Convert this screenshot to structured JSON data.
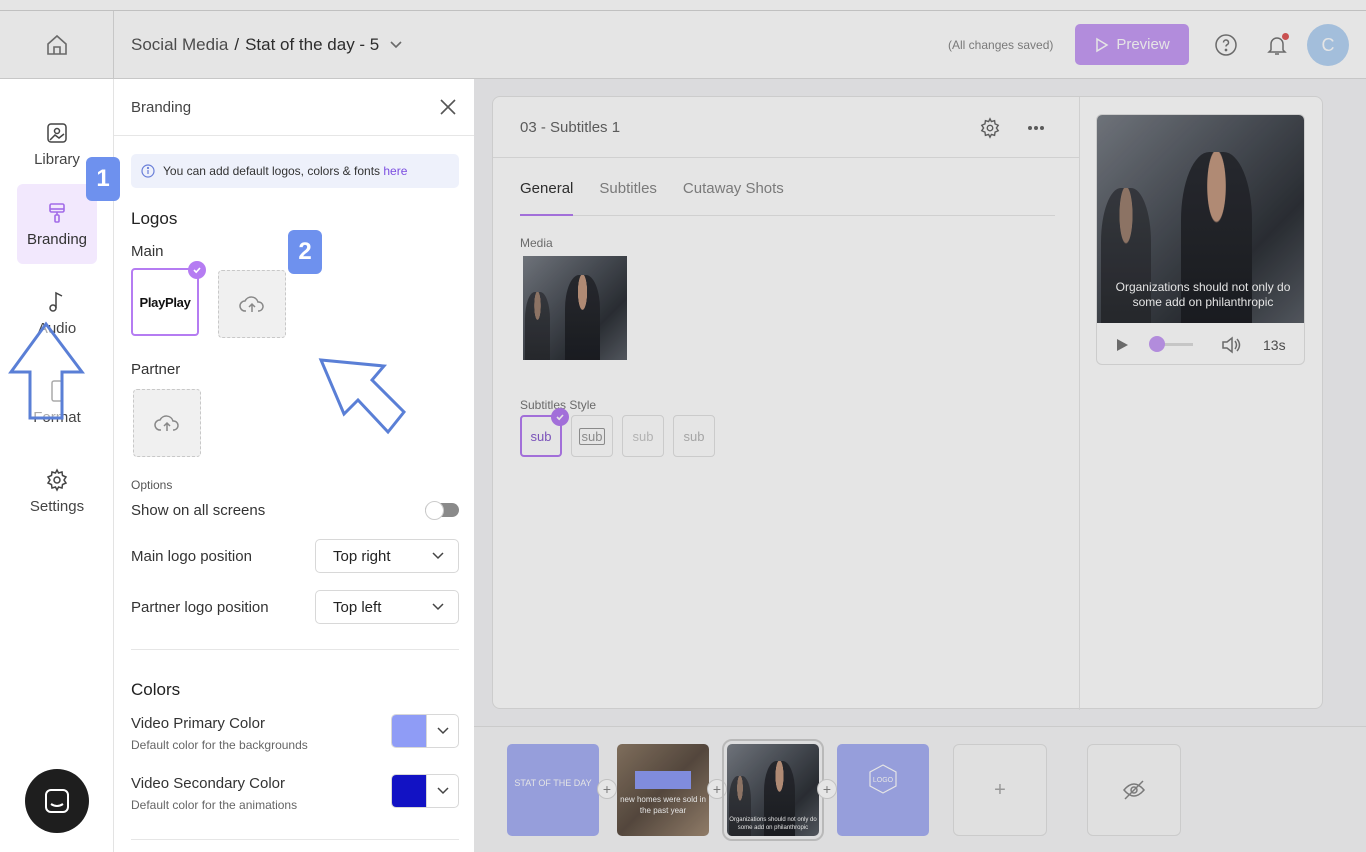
{
  "header": {
    "breadcrumb_parent": "Social Media",
    "breadcrumb_sep": "/",
    "breadcrumb_current": "Stat of the day - 5",
    "saved_status": "(All changes saved)",
    "preview_label": "Preview",
    "avatar_initial": "C"
  },
  "rail": {
    "items": [
      {
        "label": "Library",
        "icon": "image-icon"
      },
      {
        "label": "Branding",
        "icon": "paint-roller-icon"
      },
      {
        "label": "Audio",
        "icon": "music-note-icon"
      },
      {
        "label": "Format",
        "icon": "phone-format-icon"
      },
      {
        "label": "Settings",
        "icon": "gear-icon"
      }
    ]
  },
  "panel": {
    "title": "Branding",
    "info_text": "You can add default logos, colors & fonts ",
    "info_link": "here",
    "logos_title": "Logos",
    "main_label": "Main",
    "main_logo_text": "PlayPlay",
    "partner_label": "Partner",
    "options_label": "Options",
    "show_all_label": "Show on all screens",
    "main_pos_label": "Main logo position",
    "main_pos_value": "Top right",
    "partner_pos_label": "Partner logo position",
    "partner_pos_value": "Top left",
    "colors_title": "Colors",
    "primary_label": "Video Primary Color",
    "primary_desc": "Default color for the backgrounds",
    "primary_color": "#8f9cf6",
    "secondary_label": "Video Secondary Color",
    "secondary_desc": "Default color for the animations",
    "secondary_color": "#1212c4"
  },
  "main": {
    "scene_title": "03 - Subtitles 1",
    "tabs": [
      "General",
      "Subtitles",
      "Cutaway Shots"
    ],
    "media_label": "Media",
    "subtitles_style_label": "Subtitles Style",
    "sub_styles": [
      "sub",
      "sub",
      "sub",
      "sub"
    ],
    "preview_caption": "Organizations should not only do some add on philanthropic",
    "duration": "13s"
  },
  "timeline": {
    "slide1_text": "STAT OF THE DAY",
    "slide2_text": "new homes were sold in the past year",
    "slide3_text": "Organizations should not only do some add on philanthropic",
    "slide4_text": "LOGO",
    "add_label": "+"
  },
  "tutorial": {
    "step1": "1",
    "step2": "2"
  }
}
